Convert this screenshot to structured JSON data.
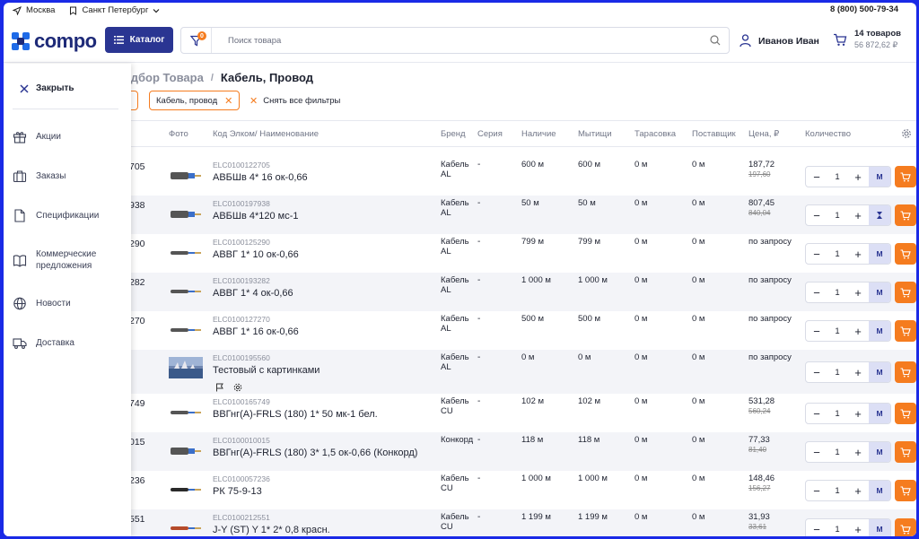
{
  "topbar": {
    "city": "Москва",
    "city2": "Санкт Петербург",
    "phone": "8 (800) 500-79-34"
  },
  "header": {
    "logo_text": "compo",
    "catalog_label": "Каталог",
    "filter_badge": "0",
    "search_placeholder": "Поиск товара",
    "user_name": "Иванов Иван",
    "cart_count": "14 товаров",
    "cart_total": "56 872,62 ₽"
  },
  "breadcrumb": {
    "prev": "одбор Товара",
    "sep": "/",
    "current": "Кабель, Провод"
  },
  "filters": {
    "chip": "Кабель, провод",
    "clear_all": "Снять все фильтры"
  },
  "table": {
    "headers": {
      "photo": "Фото",
      "code": "Код Элком/ Наименование",
      "brand": "Бренд",
      "series": "Серия",
      "stock": "Наличие",
      "mytishchi": "Мытищи",
      "tara": "Тарасовка",
      "supplier": "Поставщик",
      "price": "Цена, ₽",
      "qty": "Количество"
    },
    "rows": [
      {
        "num": "705",
        "code": "ELC0100122705",
        "name": "АВБШв 4* 16 ок-0,66",
        "brand": "Кабель AL",
        "series": "-",
        "stock": "600 м",
        "myt": "600 м",
        "tara": "0 м",
        "sup": "0 м",
        "price": "187,72",
        "old": "197,60",
        "qty": "1",
        "m": "M"
      },
      {
        "num": "938",
        "code": "ELC0100197938",
        "name": "АВБШв 4*120 мс-1",
        "brand": "Кабель AL",
        "series": "-",
        "stock": "50 м",
        "myt": "50 м",
        "tara": "0 м",
        "sup": "0 м",
        "price": "807,45",
        "old": "840,04",
        "qty": "1",
        "m": ""
      },
      {
        "num": "290",
        "code": "ELC0100125290",
        "name": "АВВГ 1* 10 ок-0,66",
        "brand": "Кабель AL",
        "series": "-",
        "stock": "799 м",
        "myt": "799 м",
        "tara": "0 м",
        "sup": "0 м",
        "price": "по запросу",
        "old": "",
        "qty": "1",
        "m": "M"
      },
      {
        "num": "282",
        "code": "ELC0100193282",
        "name": "АВВГ 1* 4 ок-0,66",
        "brand": "Кабель AL",
        "series": "-",
        "stock": "1 000 м",
        "myt": "1 000 м",
        "tara": "0 м",
        "sup": "0 м",
        "price": "по запросу",
        "old": "",
        "qty": "1",
        "m": "M"
      },
      {
        "num": "270",
        "code": "ELC0100127270",
        "name": "АВВГ 1* 16 ок-0,66",
        "brand": "Кабель AL",
        "series": "-",
        "stock": "500 м",
        "myt": "500 м",
        "tara": "0 м",
        "sup": "0 м",
        "price": "по запросу",
        "old": "",
        "qty": "1",
        "m": "M"
      },
      {
        "num": "",
        "code": "ELC0100195560",
        "name": "Тестовый с картинками",
        "brand": "Кабель AL",
        "series": "-",
        "stock": "0 м",
        "myt": "0 м",
        "tara": "0 м",
        "sup": "0 м",
        "price": "по запросу",
        "old": "",
        "qty": "1",
        "m": "M"
      },
      {
        "num": "749",
        "code": "ELC0100165749",
        "name": "ВВГнг(А)-FRLS (180) 1* 50 мк-1 бел.",
        "brand": "Кабель CU",
        "series": "-",
        "stock": "102 м",
        "myt": "102 м",
        "tara": "0 м",
        "sup": "0 м",
        "price": "531,28",
        "old": "560,24",
        "qty": "1",
        "m": "M"
      },
      {
        "num": "015",
        "code": "ELC0100010015",
        "name": "ВВГнг(А)-FRLS (180) 3* 1,5 ок-0,66 (Конкорд)",
        "brand": "Конкорд",
        "series": "-",
        "stock": "118 м",
        "myt": "118 м",
        "tara": "0 м",
        "sup": "0 м",
        "price": "77,33",
        "old": "81,40",
        "qty": "1",
        "m": "M"
      },
      {
        "num": "236",
        "code": "ELC0100057236",
        "name": "РК 75-9-13",
        "brand": "Кабель CU",
        "series": "-",
        "stock": "1 000 м",
        "myt": "1 000 м",
        "tara": "0 м",
        "sup": "0 м",
        "price": "148,46",
        "old": "156,27",
        "qty": "1",
        "m": "M"
      },
      {
        "num": "551",
        "code": "ELC0100212551",
        "name": "J-Y (ST) Y 1* 2* 0,8 красн.",
        "brand": "Кабель CU",
        "series": "-",
        "stock": "1 199 м",
        "myt": "1 199 м",
        "tara": "0 м",
        "sup": "0 м",
        "price": "31,93",
        "old": "33,61",
        "qty": "1",
        "m": "M"
      }
    ]
  },
  "sidebar": {
    "close": "Закрыть",
    "items": [
      {
        "label": "Акции",
        "icon": "gift-icon"
      },
      {
        "label": "Заказы",
        "icon": "briefcase-icon"
      },
      {
        "label": "Спецификации",
        "icon": "document-icon"
      },
      {
        "label": "Коммерческие предложения",
        "icon": "book-icon"
      },
      {
        "label": "Новости",
        "icon": "globe-icon"
      },
      {
        "label": "Доставка",
        "icon": "truck-icon"
      }
    ]
  },
  "colors": {
    "accent": "#2a3592",
    "orange": "#f57c1f",
    "frame": "#1a2ae6"
  }
}
